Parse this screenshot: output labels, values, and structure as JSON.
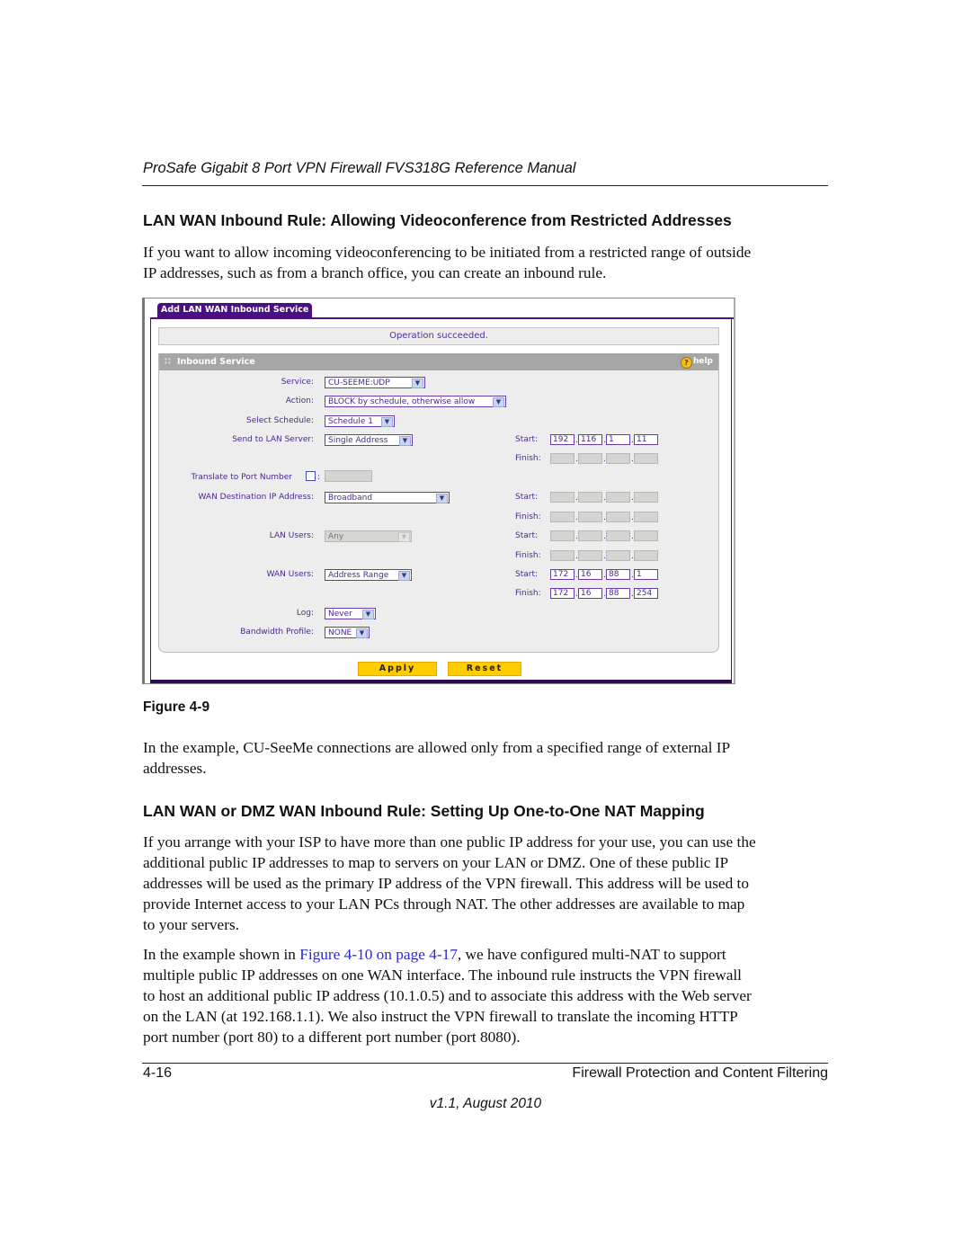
{
  "header": {
    "manual_title": "ProSafe Gigabit 8 Port VPN Firewall FVS318G Reference Manual"
  },
  "section1": {
    "heading": "LAN WAN Inbound Rule: Allowing Videoconference from Restricted Addresses",
    "intro_line1": "If you want to allow incoming videoconferencing to be initiated from a restricted range of outside",
    "intro_line2": "IP addresses, such as from a branch office, you can create an inbound rule."
  },
  "screenshot": {
    "tab_label": "Add LAN WAN Inbound Service",
    "status_message": "Operation succeeded.",
    "section_title": "Inbound Service",
    "help_label": "help",
    "fields": {
      "service": {
        "label": "Service:",
        "value": "CU-SEEME:UDP"
      },
      "action": {
        "label": "Action:",
        "value": "BLOCK by schedule, otherwise allow"
      },
      "schedule": {
        "label": "Select Schedule:",
        "value": "Schedule 1"
      },
      "lan_server": {
        "label": "Send to LAN Server:",
        "value": "Single Address"
      },
      "translate_port": {
        "label": "Translate to Port Number",
        "checked": false,
        "value": ""
      },
      "wan_dest": {
        "label": "WAN Destination IP Address:",
        "value": "Broadband"
      },
      "lan_users": {
        "label": "LAN Users:",
        "value": "Any"
      },
      "wan_users": {
        "label": "WAN Users:",
        "value": "Address Range"
      },
      "log": {
        "label": "Log:",
        "value": "Never"
      },
      "bandwidth": {
        "label": "Bandwidth Profile:",
        "value": "NONE"
      }
    },
    "ip_labels": {
      "start": "Start:",
      "finish": "Finish:"
    },
    "lan_server_ip": {
      "start": [
        "192",
        "116",
        "1",
        "11"
      ],
      "finish": [
        "",
        "",
        "",
        ""
      ]
    },
    "wan_dest_ip": {
      "start": [
        "",
        "",
        "",
        ""
      ],
      "finish": [
        "",
        "",
        "",
        ""
      ]
    },
    "lan_users_ip": {
      "start": [
        "",
        "",
        "",
        ""
      ],
      "finish": [
        "",
        "",
        "",
        ""
      ]
    },
    "wan_users_ip": {
      "start": [
        "172",
        "16",
        "88",
        "1"
      ],
      "finish": [
        "172",
        "16",
        "88",
        "254"
      ]
    },
    "buttons": {
      "apply": "Apply",
      "reset": "Reset"
    }
  },
  "figure_caption": "Figure 4-9",
  "after_figure": {
    "line1": "In the example, CU-SeeMe connections are allowed only from a specified range of external IP",
    "line2": "addresses."
  },
  "section2": {
    "heading": "LAN WAN or DMZ WAN Inbound Rule: Setting Up One-to-One NAT Mapping",
    "para1": [
      "If you arrange with your ISP to have more than one public IP address for your use, you can use the",
      "additional public IP addresses to map to servers on your LAN or DMZ. One of these public IP",
      "addresses will be used as the primary IP address of the VPN firewall. This address will be used to",
      "provide Internet access to your LAN PCs through NAT. The other addresses are available to map",
      "to your servers."
    ],
    "para2_prefix": "In the example shown in ",
    "para2_link": "Figure 4-10 on page 4-17",
    "para2_line1_suffix": ", we have configured multi-NAT to support",
    "para2_rest": [
      "multiple public IP addresses on one WAN interface.  The inbound rule instructs the VPN firewall",
      "to host an additional public IP address (10.1.0.5) and to associate this address with the Web server",
      "on the LAN (at 192.168.1.1). We also instruct the VPN firewall to translate the incoming HTTP",
      "port number (port 80) to a different port number (port 8080)."
    ]
  },
  "footer": {
    "page_number": "4-16",
    "chapter": "Firewall Protection and Content Filtering",
    "version": "v1.1, August 2010"
  }
}
